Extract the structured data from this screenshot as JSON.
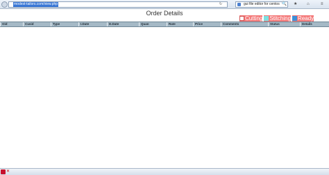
{
  "browser": {
    "url": "modest-tailors.com/view.php",
    "search_query": "gui file editor for centos",
    "refresh_symbol": "↻",
    "search_go_symbol": "🔍",
    "bookmark_symbol": "★",
    "home_symbol": "⌂",
    "menu_symbol": "≡"
  },
  "page": {
    "title": "Order Details"
  },
  "legend": {
    "items": [
      {
        "label": "Cutting",
        "color": "#ffffff"
      },
      {
        "label": "Stitching",
        "color": "#7be0e0"
      },
      {
        "label": "Ready",
        "color": "#3c8fd8"
      }
    ],
    "background": "#f47a7a"
  },
  "table": {
    "columns": [
      "Oid",
      "Cusid",
      "Type",
      "I.Date",
      "D.Date",
      "Quan",
      "Rate",
      "Price",
      "Comments",
      "Status",
      "Details"
    ]
  },
  "status_bar": {
    "close_symbol": "✕"
  }
}
